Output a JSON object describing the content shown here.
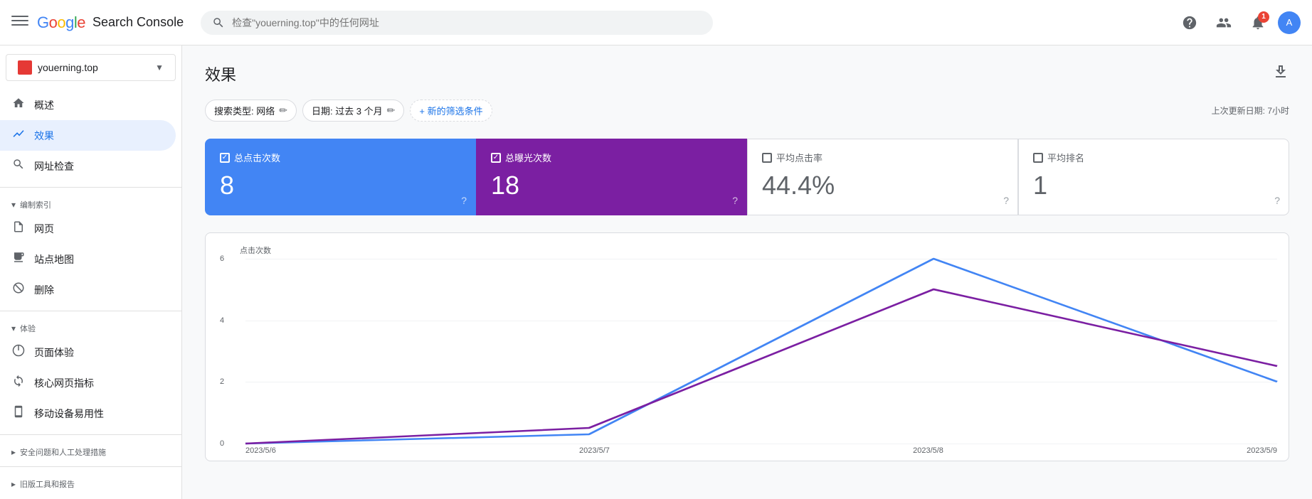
{
  "app": {
    "title": "Search Console",
    "logo_google": "Google",
    "logo_sc": "Search Console"
  },
  "topbar": {
    "search_placeholder": "检查\"youerning.top\"中的任何网址",
    "help_icon": "?",
    "users_icon": "👤",
    "notifications_count": "1",
    "menu_icon": "☰"
  },
  "sidebar": {
    "site_name": "youerning.top",
    "items": [
      {
        "id": "overview",
        "label": "概述",
        "icon": "🏠"
      },
      {
        "id": "performance",
        "label": "效果",
        "icon": "📈",
        "active": true
      },
      {
        "id": "url-inspection",
        "label": "网址检查",
        "icon": "🔍"
      }
    ],
    "sections": [
      {
        "title": "编制索引",
        "items": [
          {
            "id": "pages",
            "label": "网页",
            "icon": "📄"
          },
          {
            "id": "sitemaps",
            "label": "站点地图",
            "icon": "🗺"
          },
          {
            "id": "removals",
            "label": "删除",
            "icon": "🚫"
          }
        ]
      },
      {
        "title": "体验",
        "items": [
          {
            "id": "page-experience",
            "label": "页面体验",
            "icon": "⊕"
          },
          {
            "id": "core-web-vitals",
            "label": "核心网页指标",
            "icon": "↻"
          },
          {
            "id": "mobile-usability",
            "label": "移动设备易用性",
            "icon": "📱"
          }
        ]
      },
      {
        "title": "安全问题和人工处理措施",
        "items": []
      },
      {
        "title": "旧版工具和报告",
        "items": []
      }
    ]
  },
  "main": {
    "page_title": "效果",
    "download_label": "⬇",
    "filters": {
      "search_type": "搜索类型: 网络",
      "date": "日期: 过去 3 个月",
      "add_filter": "+ 新的筛选条件"
    },
    "last_updated": "上次更新日期: 7小时",
    "metrics": [
      {
        "id": "clicks",
        "label": "总点击次数",
        "value": "8",
        "checked": true,
        "style": "active-blue"
      },
      {
        "id": "impressions",
        "label": "总曝光次数",
        "value": "18",
        "checked": true,
        "style": "active-purple"
      },
      {
        "id": "ctr",
        "label": "平均点击率",
        "value": "44.4%",
        "checked": false,
        "style": "inactive"
      },
      {
        "id": "position",
        "label": "平均排名",
        "value": "1",
        "checked": false,
        "style": "inactive"
      }
    ],
    "chart": {
      "y_label": "点击次数",
      "y_max": 6,
      "y_ticks": [
        0,
        2,
        4,
        6
      ],
      "x_labels": [
        "2023/5/6",
        "2023/5/7",
        "2023/5/8",
        "2023/5/9"
      ],
      "series_blue_label": "总点击次数",
      "series_purple_label": "总曝光次数",
      "data_blue": [
        0,
        0.3,
        6,
        2
      ],
      "data_purple": [
        0,
        0.5,
        5,
        2.5
      ]
    }
  }
}
